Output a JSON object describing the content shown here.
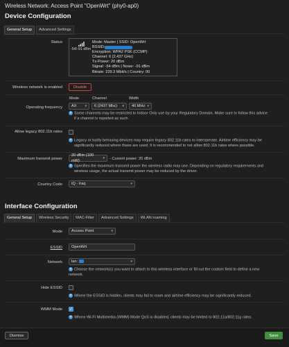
{
  "page": {
    "title": "Wireless Network: Access Point \"OpenWrt\" (phy0-ap0)"
  },
  "device": {
    "heading": "Device Configuration",
    "tabs": [
      "General Setup",
      "Advanced Settings"
    ],
    "status_label": "Status",
    "signal_dbm": "-54/-91 dBm",
    "status_lines": {
      "mode": "Mode: Master | SSID: OpenWrt",
      "bssid": "BSSID:",
      "encryption": "Encryption: WPA2 PSK (CCMP)",
      "channel": "Channel: 6 (2.437 GHz)",
      "txpower": "Tx-Power: 20 dBm",
      "signal": "Signal: -54 dBm | Noise: -91 dBm",
      "bitrate": "Bitrate: 229.3 Mbit/s | Country: 00"
    },
    "enabled_label": "Wireless network is enabled",
    "disable_btn": "Disable",
    "opfreq_label": "Operating frequency",
    "mode_col": "Mode",
    "channel_col": "Channel",
    "width_col": "Width",
    "mode_val": "AX",
    "channel_val": "6 (2437 Mhz)",
    "width_val": "40 MHz",
    "opfreq_help_1": "Some channels may be restricted to Indoor Only use by your Regulatory Domain. Make sure to follow this advice",
    "opfreq_help_2": "if a channel is reported as such.",
    "legacy_label": "Allow legacy 802.11b rates",
    "legacy_help_1": "Legacy or badly behaving devices may require legacy 802.11b rates to interoperate. Airtime efficiency may be",
    "legacy_help_2": "significantly reduced where these are used. It is recommended to not allow 802.11b rates where possible.",
    "txpower_label": "Maximum transmit power",
    "txpower_val": "20 dBm (100 mW)",
    "txpower_current": "- Current power: 20 dBm",
    "txpower_help_1": "Specifies the maximum transmit power the wireless radio may use. Depending on regulatory requirements and",
    "txpower_help_2": "wireless usage, the actual transmit power may be reduced by the driver.",
    "country_label": "Country Code",
    "country_val": "IQ - Iraq"
  },
  "iface": {
    "heading": "Interface Configuration",
    "tabs": [
      "General Setup",
      "Wireless Security",
      "MAC-Filter",
      "Advanced Settings",
      "WLAN roaming"
    ],
    "mode_label": "Mode",
    "mode_val": "Access Point",
    "essid_label": "ESSID",
    "essid_val": "OpenWrt",
    "network_label": "Network",
    "network_prefix": "lan:",
    "network_val": "lan: ",
    "network_help_1": "Choose the network(s) you want to attach to this wireless interface or fill out the custom field to define a new",
    "network_help_2": "network.",
    "hide_label": "Hide ESSID",
    "hide_help": "Where the ESSID is hidden, clients may fail to roam and airtime efficiency may be significantly reduced.",
    "wmm_label": "WMM Mode",
    "wmm_help": "Where Wi-Fi Multimedia (WMM) Mode QoS is disabled, clients may be limited to 802.11a/802.11g rates."
  },
  "footer": {
    "dismiss": "Dismiss",
    "save": "Save"
  },
  "icons": {
    "help": "info-icon",
    "signal": "signal-bars-icon",
    "caret": "chevron-down-icon"
  },
  "colors": {
    "accent": "#4a9ad8",
    "disable_red": "#c9443f",
    "save_green": "#3f8f3f",
    "redact_blue": "#2a7fd4"
  }
}
